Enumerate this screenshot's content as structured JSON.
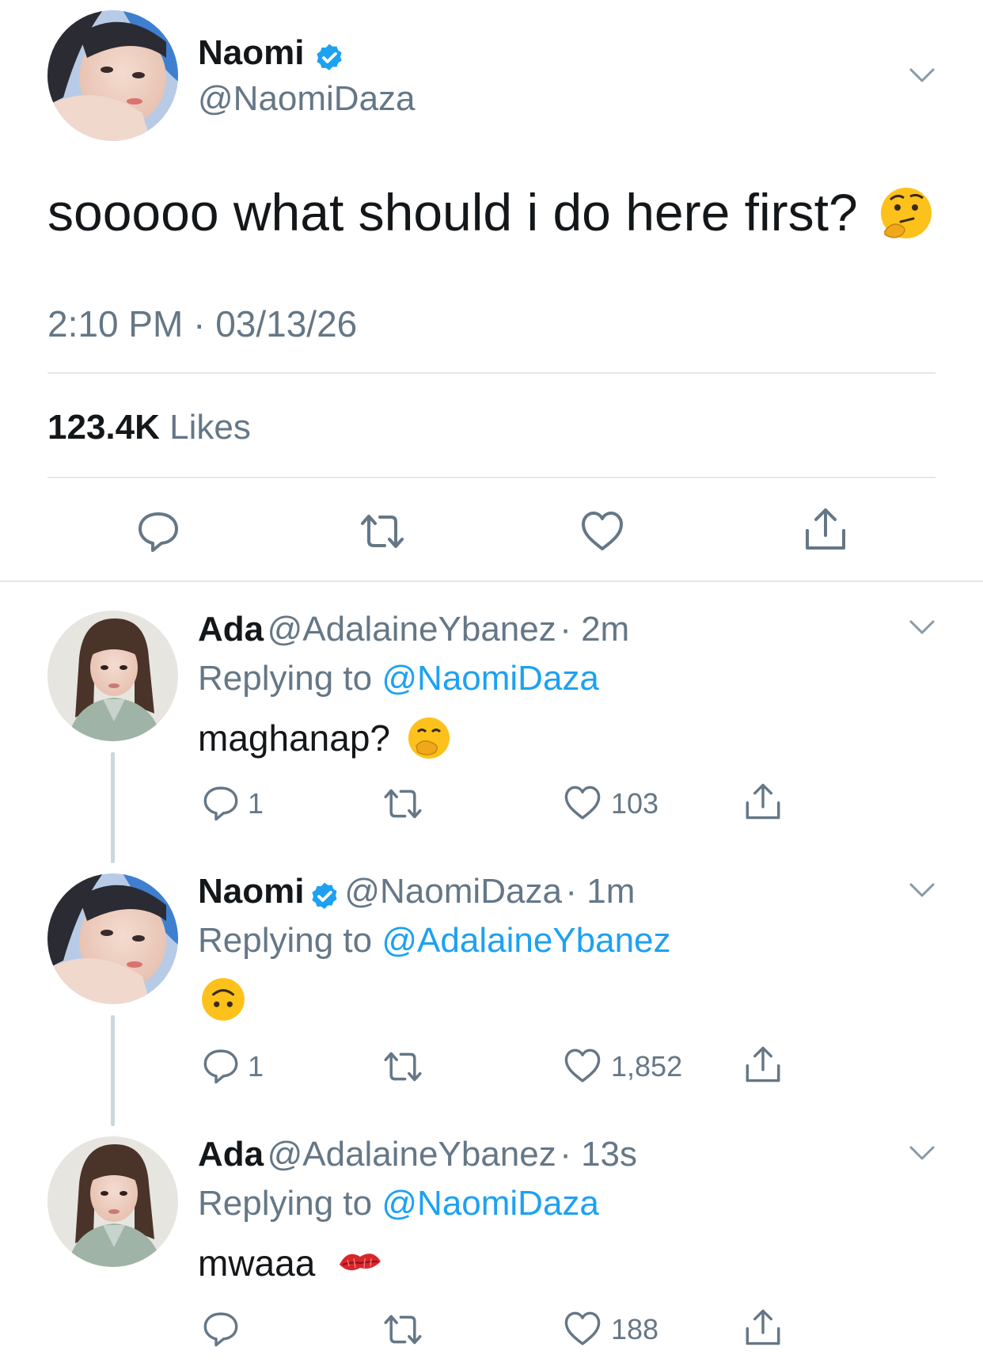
{
  "main_tweet": {
    "name": "Naomi",
    "handle": "@NaomiDaza",
    "text": "sooooo what should i do here first?",
    "emoji": "thinking-face",
    "timestamp": "2:10 PM · 03/13/26",
    "likes_count": "123.4K",
    "likes_label": "Likes",
    "verified": true
  },
  "replies": [
    {
      "name": "Ada",
      "handle": "@AdalaineYbanez",
      "age": "· 2m",
      "replying_prefix": "Replying to",
      "replying_to": "@NaomiDaza",
      "text": "maghanap?",
      "emoji": "hand-over-mouth",
      "reply_count": "1",
      "like_count": "103",
      "verified": false
    },
    {
      "name": "Naomi",
      "handle": "@NaomiDaza",
      "age": "· 1m",
      "replying_prefix": "Replying to",
      "replying_to": "@AdalaineYbanez",
      "text": "",
      "emoji": "upside-down-face",
      "reply_count": "1",
      "like_count": "1,852",
      "verified": true
    },
    {
      "name": "Ada",
      "handle": "@AdalaineYbanez",
      "age": "· 13s",
      "replying_prefix": "Replying to",
      "replying_to": "@NaomiDaza",
      "text": "mwaaa",
      "emoji": "kiss-mark",
      "reply_count": "",
      "like_count": "188",
      "verified": false
    }
  ],
  "colors": {
    "text": "#14171a",
    "muted": "#657786",
    "link": "#1da1f2",
    "verified": "#1da1f2",
    "divider": "#e1e8ed"
  }
}
